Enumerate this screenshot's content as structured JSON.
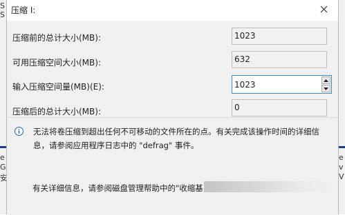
{
  "window": {
    "title": "压缩 I:"
  },
  "rows": {
    "total_before": {
      "label": "压缩前的总计大小(MB):",
      "value": "1023"
    },
    "available": {
      "label": "可用压缩空间大小(MB):",
      "value": "632"
    },
    "shrink_amount": {
      "label": "输入压缩空间量(MB)(E):",
      "value": "1023"
    },
    "total_after": {
      "label": "压缩后的总计大小(MB):",
      "value": "0"
    }
  },
  "info": {
    "message": "无法将卷压缩到超出任何不可移动的文件所在的点。有关完成该操作时间的详细信息，请参阅应用程序日志中的 \"defrag\" 事件。",
    "help": "有关详细信息，请参阅磁盘管理帮助中的\"收缩基"
  },
  "background": {
    "left_chars": [
      "S",
      "S",
      "e",
      "G",
      "安"
    ],
    "right_chars": [
      "e",
      "v",
      "V"
    ]
  },
  "icons": {
    "close": "close-icon",
    "info": "info-icon",
    "spin_up": "chevron-up-icon",
    "spin_down": "chevron-down-icon"
  },
  "colors": {
    "focus_border": "#3c8bd8",
    "panel_bg": "#f0f0f0",
    "info_icon": "#1a5fb4"
  }
}
